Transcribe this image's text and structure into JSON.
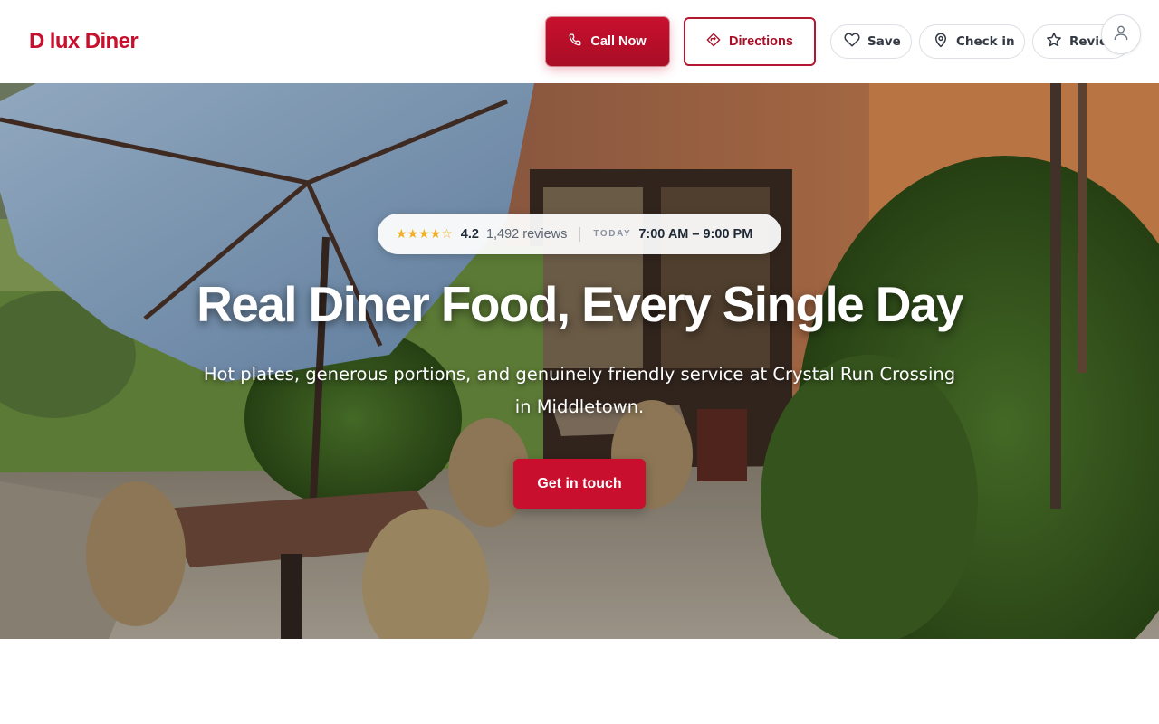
{
  "brand": {
    "name": "D lux Diner",
    "color": "#c8102e"
  },
  "header": {
    "call_label": "Call Now",
    "directions_label": "Directions",
    "save_label": "Save",
    "checkin_label": "Check in",
    "review_label": "Review"
  },
  "hero": {
    "rating": "4.2",
    "stars": "★★★★☆",
    "stars_value": 4.2,
    "review_count": "1,492 reviews",
    "today_label": "TODAY",
    "hours": "7:00 AM – 9:00 PM",
    "headline": "Real Diner Food, Every Single Day",
    "subtitle": "Hot plates, generous portions, and genuinely friendly service at Crystal Run Crossing in Middletown.",
    "cta_label": "Get in touch"
  },
  "icons": {
    "call": "phone-icon",
    "directions": "directions-icon",
    "save": "heart-icon",
    "checkin": "location-pin-icon",
    "review": "star-icon",
    "account": "user-icon"
  },
  "colors": {
    "accent": "#c8102e",
    "star": "#f2b01e"
  }
}
